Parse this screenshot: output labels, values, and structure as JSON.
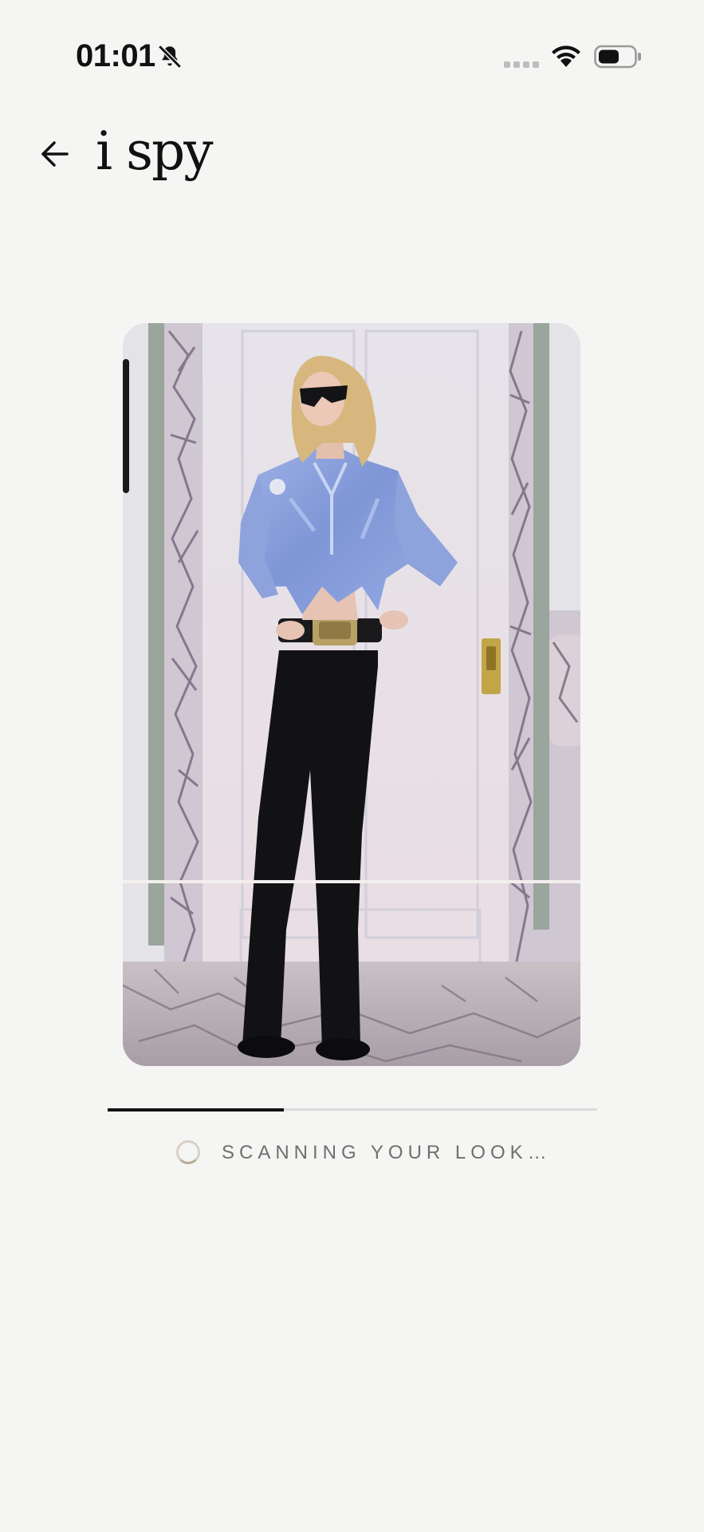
{
  "status_bar": {
    "time": "01:01",
    "icons": [
      "bell-slash-icon",
      "signal-icon",
      "wifi-icon",
      "battery-icon"
    ]
  },
  "header": {
    "back_icon": "arrow-left-icon",
    "app_name": "i spy"
  },
  "scan": {
    "image_alt": "Outfit photo: woman in light blue satin shirt, gold buckle belt and black flared trousers against a white door",
    "progress": 0.36,
    "status_text": "SCANNING YOUR LOOK…"
  },
  "colors": {
    "background": "#f5f5f3",
    "text": "#111111",
    "status_text": "#6f6f6f",
    "spinner": "#b9ab97",
    "progress_track": "#dcdcdc",
    "progress_fill": "#111111"
  }
}
